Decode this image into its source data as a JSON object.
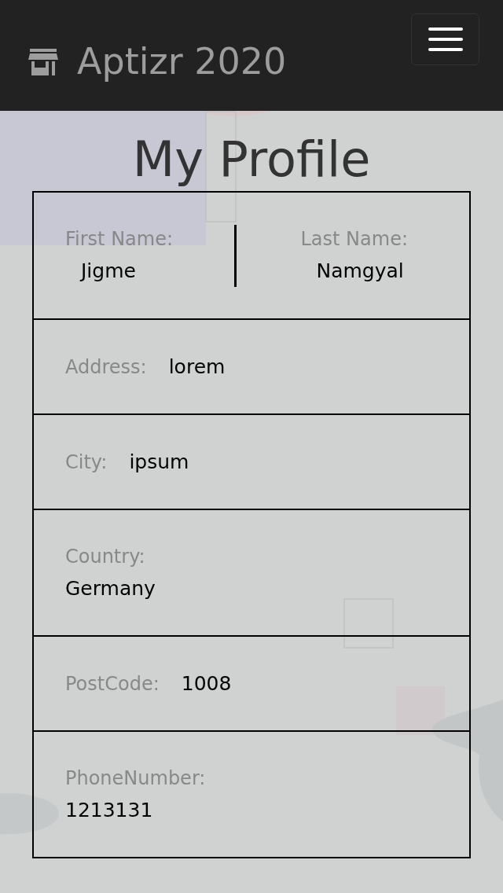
{
  "navbar": {
    "brand": "Aptizr 2020"
  },
  "title": "My Profile",
  "name_row": [
    {
      "label": "First Name:",
      "value": "Jigme"
    },
    {
      "label": "Last Name:",
      "value": "Namgyal"
    }
  ],
  "fields": [
    {
      "kind": "inline",
      "label": "Address:",
      "value": "lorem"
    },
    {
      "kind": "inline",
      "label": "City:",
      "value": "ipsum"
    },
    {
      "kind": "stacked",
      "label": "Country:",
      "value": "Germany"
    },
    {
      "kind": "inline",
      "label": "PostCode:",
      "value": "1008"
    },
    {
      "kind": "stacked",
      "label": "PhoneNumber:",
      "value": "1213131"
    }
  ]
}
